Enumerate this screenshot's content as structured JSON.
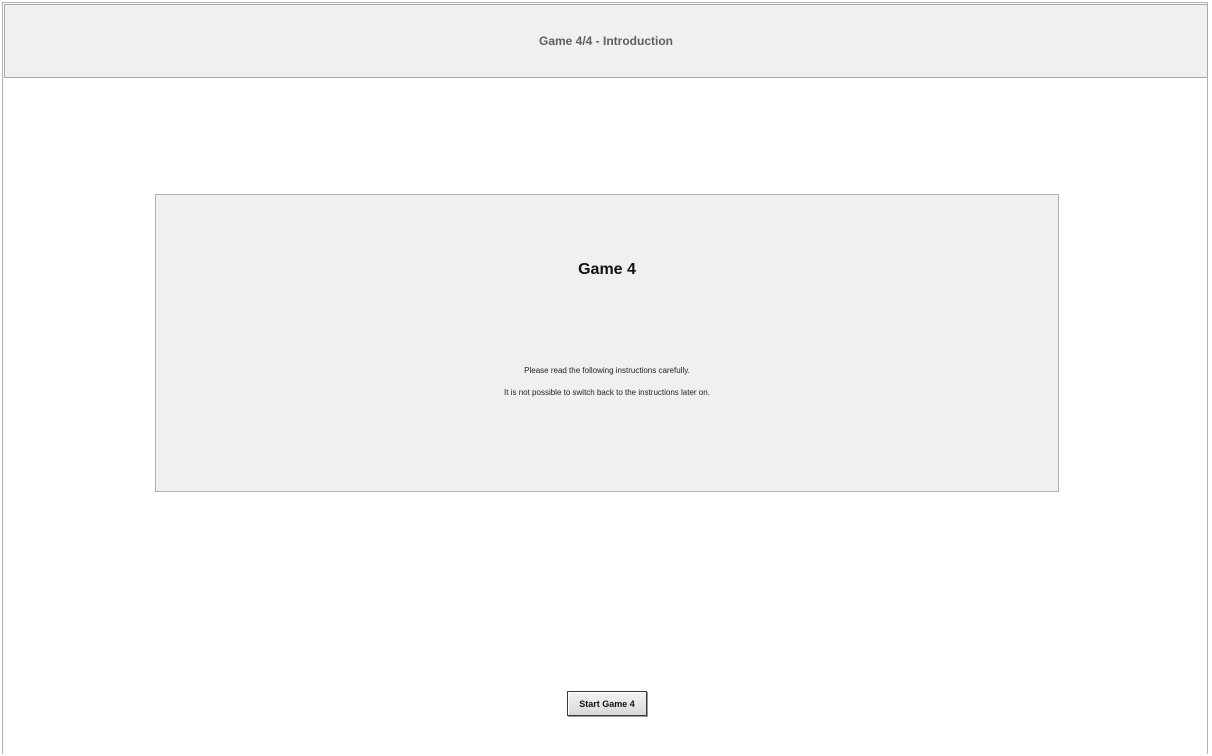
{
  "header": {
    "title": "Game 4/4 - Introduction"
  },
  "panel": {
    "title": "Game 4",
    "instructions": [
      "Please read the following instructions carefully.",
      "It is not possible to switch back to the instructions later on."
    ]
  },
  "actions": {
    "start_label": "Start Game 4"
  },
  "colors": {
    "header_background": "#f0f0f0",
    "panel_background": "#f0f0f0",
    "page_background": "#ffffff"
  }
}
